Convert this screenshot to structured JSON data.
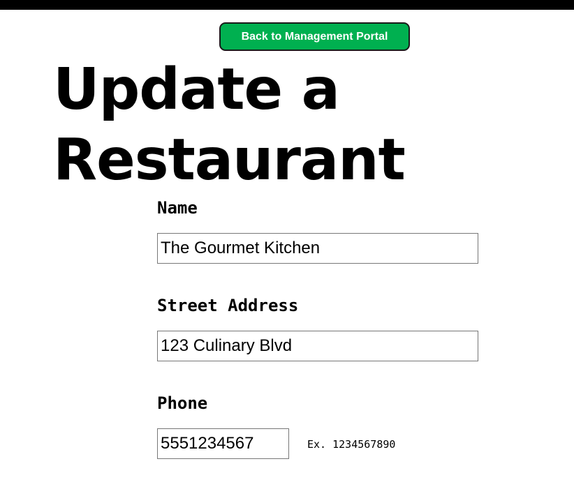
{
  "header": {
    "back_button_label": "Back to Management Portal"
  },
  "page": {
    "title": "Update a Restaurant"
  },
  "form": {
    "name": {
      "label": "Name",
      "value": "The Gourmet Kitchen"
    },
    "street_address": {
      "label": "Street Address",
      "value": "123 Culinary Blvd"
    },
    "phone": {
      "label": "Phone",
      "value": "5551234567",
      "hint": "Ex. 1234567890"
    }
  },
  "colors": {
    "top_bar": "#000000",
    "back_button_bg": "#00b050",
    "text": "#000000"
  }
}
